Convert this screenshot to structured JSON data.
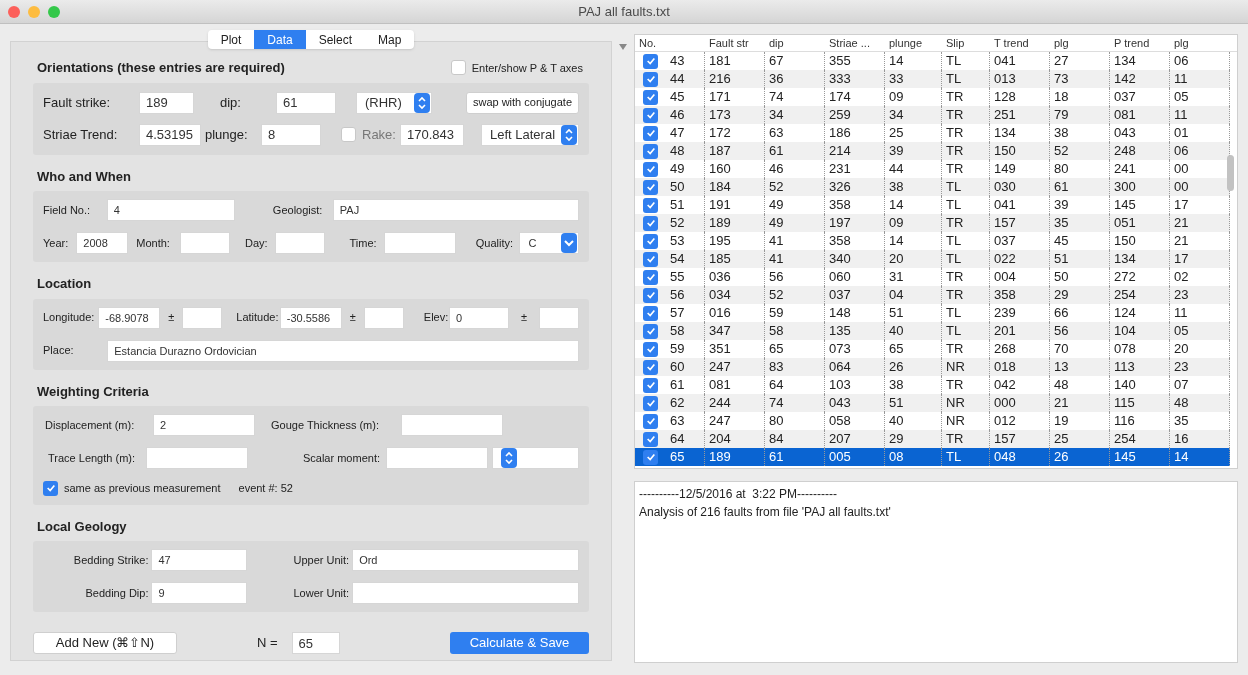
{
  "window": {
    "title": "PAJ all faults.txt"
  },
  "tabs": [
    {
      "label": "Plot",
      "selected": false
    },
    {
      "label": "Data",
      "selected": true
    },
    {
      "label": "Select",
      "selected": false
    },
    {
      "label": "Map",
      "selected": false
    }
  ],
  "orientations": {
    "title": "Orientations (these entries are required)",
    "pt_axes": {
      "label": "Enter/show P & T axes",
      "checked": false
    },
    "fault_strike": {
      "label": "Fault strike:",
      "value": "189"
    },
    "dip": {
      "label": "dip:",
      "value": "61"
    },
    "convention": {
      "value": "(RHR)"
    },
    "swap_button": "swap with conjugate",
    "striae_trend": {
      "label": "Striae Trend:",
      "value": "4.53195"
    },
    "plunge": {
      "label": "plunge:",
      "value": "8"
    },
    "rake": {
      "label": "Rake:",
      "checked": false,
      "value": "170.843"
    },
    "sense": {
      "value": "Left Lateral"
    }
  },
  "who_when": {
    "title": "Who and When",
    "field_no": {
      "label": "Field No.:",
      "value": "4"
    },
    "geologist": {
      "label": "Geologist:",
      "value": "PAJ"
    },
    "year": {
      "label": "Year:",
      "value": "2008"
    },
    "month": {
      "label": "Month:"
    },
    "day": {
      "label": "Day:"
    },
    "time": {
      "label": "Time:"
    },
    "quality": {
      "label": "Quality:",
      "value": "C"
    }
  },
  "location": {
    "title": "Location",
    "longitude": {
      "label": "Longitude:",
      "value": "-68.9078",
      "pm": "±"
    },
    "latitude": {
      "label": "Latitude:",
      "value": "-30.5586",
      "pm": "±"
    },
    "elev": {
      "label": "Elev:",
      "value": "0",
      "pm": "±"
    },
    "place": {
      "label": "Place:",
      "value": "Estancia Durazno Ordovician"
    }
  },
  "weighting": {
    "title": "Weighting Criteria",
    "displacement": {
      "label": "Displacement (m):",
      "value": "2"
    },
    "gouge": {
      "label": "Gouge Thickness (m):"
    },
    "trace": {
      "label": "Trace Length (m):"
    },
    "scalar": {
      "label": "Scalar moment:"
    },
    "same_as_previous": {
      "label": "same as previous measurement",
      "checked": true
    },
    "event": "event #: 52"
  },
  "local_geology": {
    "title": "Local Geology",
    "bedding_strike": {
      "label": "Bedding Strike:",
      "value": "47"
    },
    "upper_unit": {
      "label": "Upper Unit:",
      "value": "Ord"
    },
    "bedding_dip": {
      "label": "Bedding Dip:",
      "value": "9"
    },
    "lower_unit": {
      "label": "Lower Unit:"
    }
  },
  "add_button": "Add New (⌘⇧N)",
  "n": {
    "label": "N =",
    "value": "65"
  },
  "calculate_button": "Calculate & Save",
  "table": {
    "columns": [
      "No.",
      "Fault str",
      "dip",
      "Striae ...",
      "plunge",
      "Slip",
      "T trend",
      "plg",
      "P trend",
      "plg"
    ],
    "rows": [
      {
        "checked": true,
        "selected": false,
        "cells": [
          "43",
          "181",
          "67",
          "355",
          "14",
          "TL",
          "041",
          "27",
          "134",
          "06"
        ]
      },
      {
        "checked": true,
        "selected": false,
        "cells": [
          "44",
          "216",
          "36",
          "333",
          "33",
          "TL",
          "013",
          "73",
          "142",
          "11"
        ]
      },
      {
        "checked": true,
        "selected": false,
        "cells": [
          "45",
          "171",
          "74",
          "174",
          "09",
          "TR",
          "128",
          "18",
          "037",
          "05"
        ]
      },
      {
        "checked": true,
        "selected": false,
        "cells": [
          "46",
          "173",
          "34",
          "259",
          "34",
          "TR",
          "251",
          "79",
          "081",
          "11"
        ]
      },
      {
        "checked": true,
        "selected": false,
        "cells": [
          "47",
          "172",
          "63",
          "186",
          "25",
          "TR",
          "134",
          "38",
          "043",
          "01"
        ]
      },
      {
        "checked": true,
        "selected": false,
        "cells": [
          "48",
          "187",
          "61",
          "214",
          "39",
          "TR",
          "150",
          "52",
          "248",
          "06"
        ]
      },
      {
        "checked": true,
        "selected": false,
        "cells": [
          "49",
          "160",
          "46",
          "231",
          "44",
          "TR",
          "149",
          "80",
          "241",
          "00"
        ]
      },
      {
        "checked": true,
        "selected": false,
        "cells": [
          "50",
          "184",
          "52",
          "326",
          "38",
          "TL",
          "030",
          "61",
          "300",
          "00"
        ]
      },
      {
        "checked": true,
        "selected": false,
        "cells": [
          "51",
          "191",
          "49",
          "358",
          "14",
          "TL",
          "041",
          "39",
          "145",
          "17"
        ]
      },
      {
        "checked": true,
        "selected": false,
        "cells": [
          "52",
          "189",
          "49",
          "197",
          "09",
          "TR",
          "157",
          "35",
          "051",
          "21"
        ]
      },
      {
        "checked": true,
        "selected": false,
        "cells": [
          "53",
          "195",
          "41",
          "358",
          "14",
          "TL",
          "037",
          "45",
          "150",
          "21"
        ]
      },
      {
        "checked": true,
        "selected": false,
        "cells": [
          "54",
          "185",
          "41",
          "340",
          "20",
          "TL",
          "022",
          "51",
          "134",
          "17"
        ]
      },
      {
        "checked": true,
        "selected": false,
        "cells": [
          "55",
          "036",
          "56",
          "060",
          "31",
          "TR",
          "004",
          "50",
          "272",
          "02"
        ]
      },
      {
        "checked": true,
        "selected": false,
        "cells": [
          "56",
          "034",
          "52",
          "037",
          "04",
          "TR",
          "358",
          "29",
          "254",
          "23"
        ]
      },
      {
        "checked": true,
        "selected": false,
        "cells": [
          "57",
          "016",
          "59",
          "148",
          "51",
          "TL",
          "239",
          "66",
          "124",
          "11"
        ]
      },
      {
        "checked": true,
        "selected": false,
        "cells": [
          "58",
          "347",
          "58",
          "135",
          "40",
          "TL",
          "201",
          "56",
          "104",
          "05"
        ]
      },
      {
        "checked": true,
        "selected": false,
        "cells": [
          "59",
          "351",
          "65",
          "073",
          "65",
          "TR",
          "268",
          "70",
          "078",
          "20"
        ]
      },
      {
        "checked": true,
        "selected": false,
        "cells": [
          "60",
          "247",
          "83",
          "064",
          "26",
          "NR",
          "018",
          "13",
          "113",
          "23"
        ]
      },
      {
        "checked": true,
        "selected": false,
        "cells": [
          "61",
          "081",
          "64",
          "103",
          "38",
          "TR",
          "042",
          "48",
          "140",
          "07"
        ]
      },
      {
        "checked": true,
        "selected": false,
        "cells": [
          "62",
          "244",
          "74",
          "043",
          "51",
          "NR",
          "000",
          "21",
          "115",
          "48"
        ]
      },
      {
        "checked": true,
        "selected": false,
        "cells": [
          "63",
          "247",
          "80",
          "058",
          "40",
          "NR",
          "012",
          "19",
          "116",
          "35"
        ]
      },
      {
        "checked": true,
        "selected": false,
        "cells": [
          "64",
          "204",
          "84",
          "207",
          "29",
          "TR",
          "157",
          "25",
          "254",
          "16"
        ]
      },
      {
        "checked": true,
        "selected": true,
        "cells": [
          "65",
          "189",
          "61",
          "005",
          "08",
          "TL",
          "048",
          "26",
          "145",
          "14"
        ]
      }
    ]
  },
  "output": {
    "lines": [
      "----------12/5/2016 at  3:22 PM----------",
      "Analysis of 216 faults from file 'PAJ all faults.txt'"
    ]
  }
}
